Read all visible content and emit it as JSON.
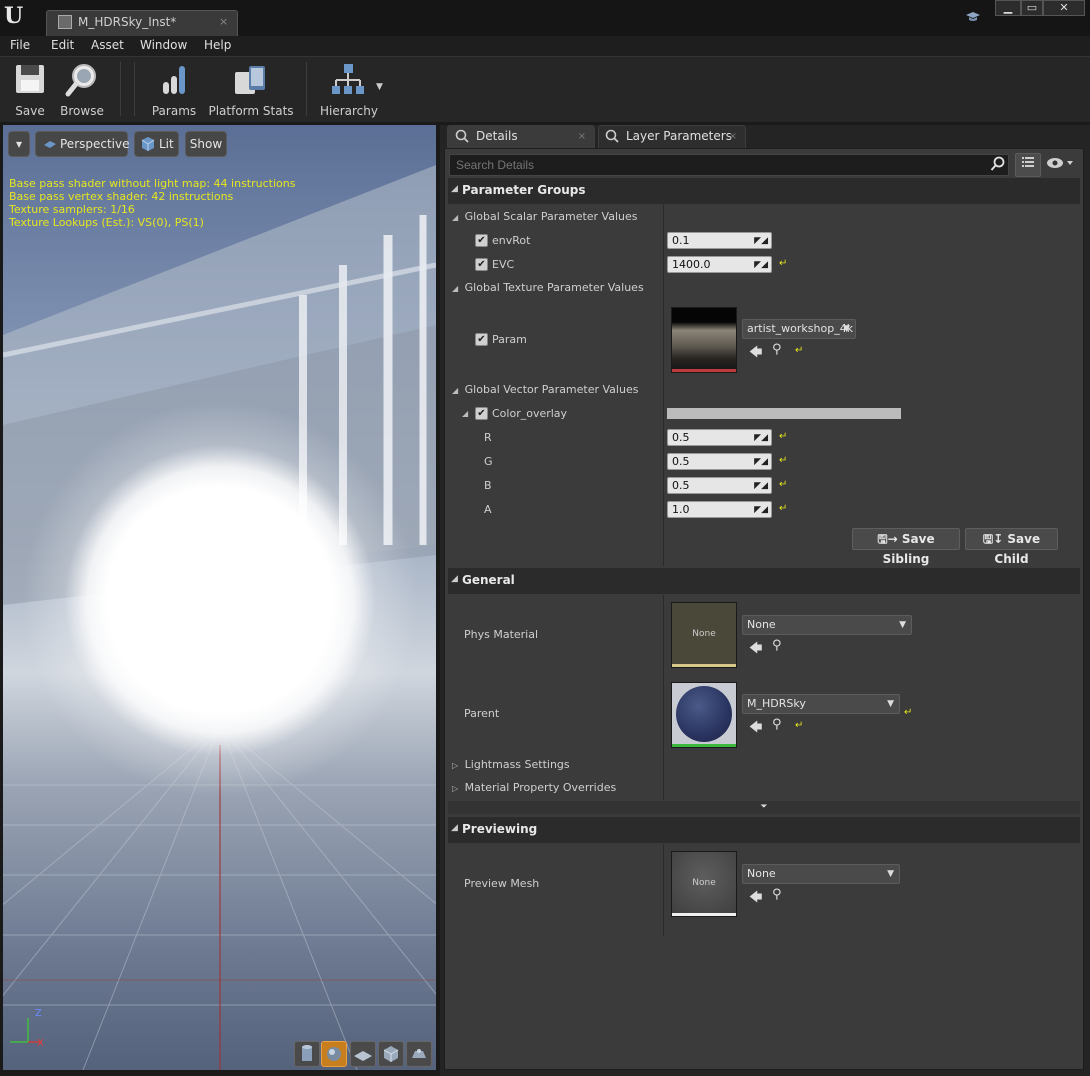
{
  "window": {
    "doc_tab_title": "M_HDRSky_Inst*",
    "doc_tab_close": "×",
    "min_glyph": "▁",
    "max_glyph": "▭",
    "close_glyph": "✕",
    "logo_glyph": "U"
  },
  "menu": {
    "items": [
      "File",
      "Edit",
      "Asset",
      "Window",
      "Help"
    ]
  },
  "toolbar": {
    "save_label": "Save",
    "browse_label": "Browse",
    "params_label": "Params",
    "platform_stats_label": "Platform Stats",
    "hierarchy_label": "Hierarchy"
  },
  "viewport": {
    "perspective_label": "Perspective",
    "lit_label": "Lit",
    "show_label": "Show",
    "stats": [
      "Base pass shader without light map: 44 instructions",
      "Base pass vertex shader: 42 instructions",
      "Texture samplers: 1/16",
      "Texture Lookups (Est.): VS(0), PS(1)"
    ],
    "axis_z": "Z",
    "axis_x": "X"
  },
  "tabs": {
    "details": "Details",
    "layer_parameters": "Layer Parameters",
    "close_glyph": "×"
  },
  "search": {
    "placeholder": "Search Details"
  },
  "parameter_groups": {
    "header": "Parameter Groups",
    "scalar_group": "Global Scalar Parameter Values",
    "env_rot_label": "envRot",
    "env_rot_value": "0.1",
    "evc_label": "EVC",
    "evc_value": "1400.0",
    "texture_group": "Global Texture Parameter Values",
    "param_label": "Param",
    "param_texture": "artist_workshop_4k",
    "vector_group": "Global Vector Parameter Values",
    "color_overlay_label": "Color_overlay",
    "r_label": "R",
    "r_value": "0.5",
    "g_label": "G",
    "g_value": "0.5",
    "b_label": "B",
    "b_value": "0.5",
    "a_label": "A",
    "a_value": "1.0",
    "save_sibling": "Save Sibling",
    "save_child": "Save Child"
  },
  "general": {
    "header": "General",
    "phys_material_label": "Phys Material",
    "phys_material_thumb": "None",
    "phys_material_value": "None",
    "parent_label": "Parent",
    "parent_value": "M_HDRSky",
    "lightmass_label": "Lightmass Settings",
    "overrides_label": "Material Property Overrides"
  },
  "previewing": {
    "header": "Previewing",
    "preview_mesh_label": "Preview Mesh",
    "preview_mesh_thumb": "None",
    "preview_mesh_value": "None"
  },
  "colors": {
    "stat_text": "#e6e61e",
    "reset_arrow": "#e6e61e",
    "parent_thumb_bar": "#3cb83c",
    "texture_thumb_bar": "#c0393b",
    "phys_thumb_bar": "#d8c88a"
  }
}
